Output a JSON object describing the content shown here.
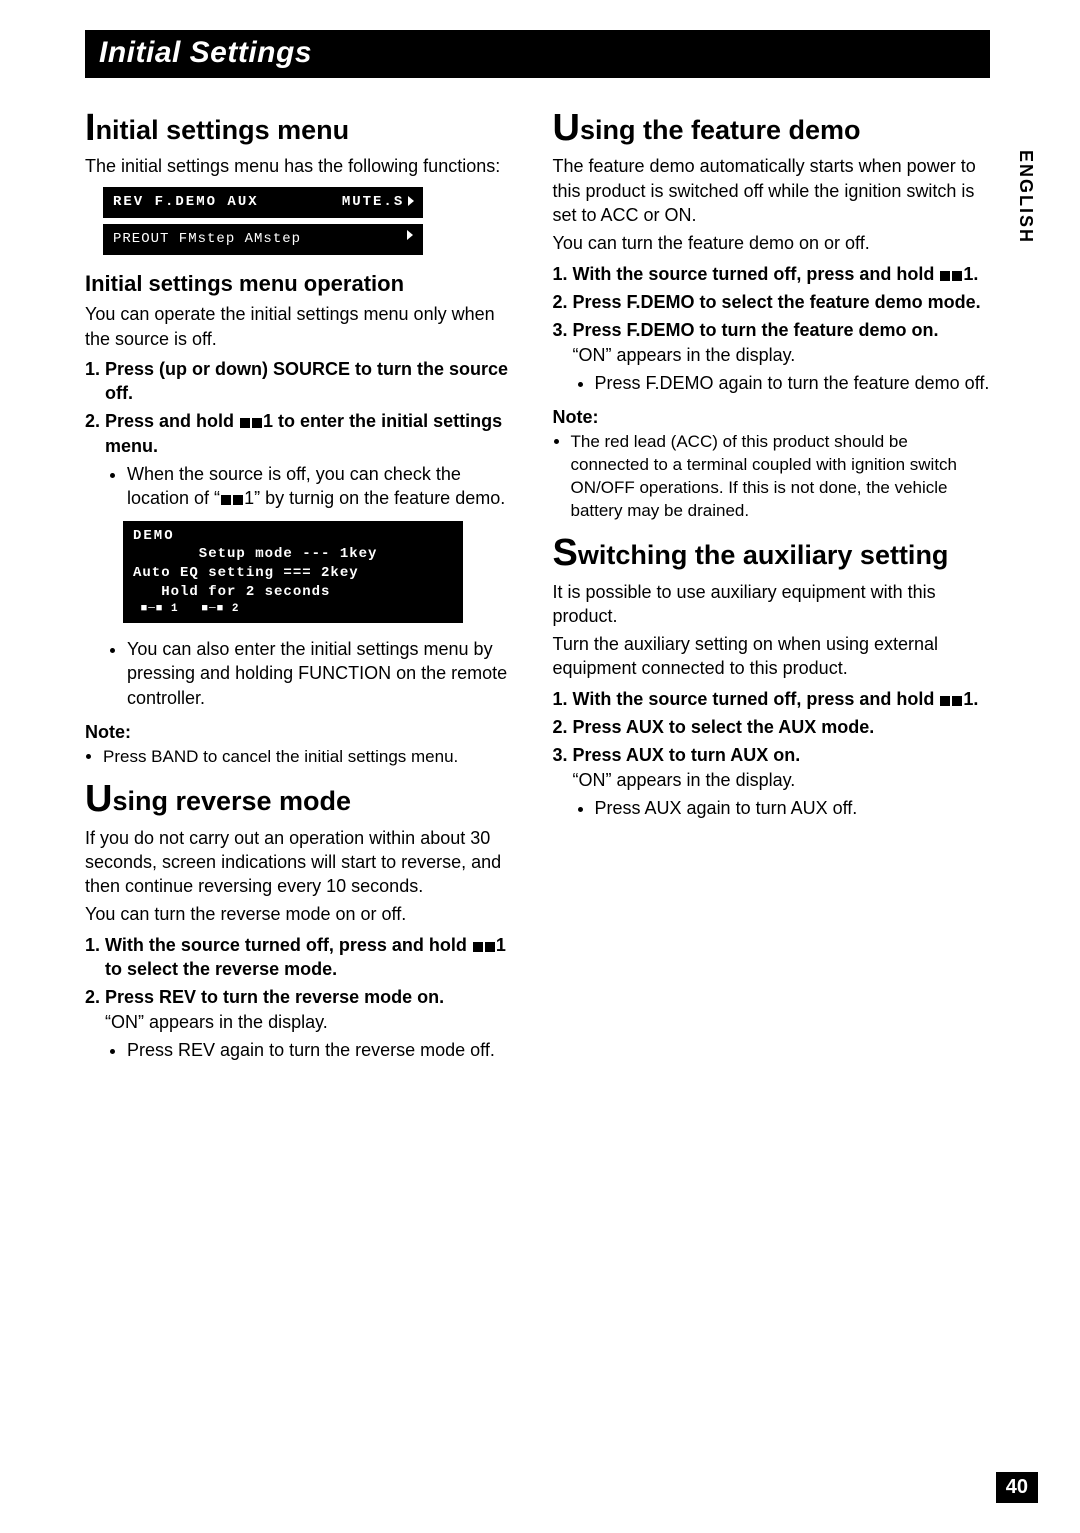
{
  "header": {
    "title": "Initial Settings"
  },
  "lang_tab": "ENGLISH",
  "page_number": "40",
  "left": {
    "h1": {
      "first": "I",
      "rest": "nitial settings menu"
    },
    "intro": "The initial settings menu has the following functions:",
    "lcd1": {
      "row1": "REV F.DEMO AUX        MUTE.S",
      "row2": "PREOUT FMstep AMstep"
    },
    "h2": "Initial settings menu operation",
    "p1": "You can operate the initial settings menu only when the source is off.",
    "step1": "Press (up or down) SOURCE to turn the source off.",
    "step2a": "Press and hold ",
    "step2b": "1 to enter the initial settings menu.",
    "sub1a": "When the source is off, you can check the location of “",
    "sub1b": "1” by turnig on the feature demo.",
    "lcd2": {
      "title": "DEMO",
      "l1": "       Setup mode --- 1key",
      "l2": "Auto EQ setting === 2key",
      "l3": "   Hold for 2 seconds",
      "l4": " ■─■ 1   ■─■ 2"
    },
    "sub2": "You can also enter the initial settings menu by pressing and holding FUNCTION on the remote controller.",
    "note_label": "Note:",
    "note_body": "Press BAND to cancel the initial settings menu.",
    "h3": {
      "first": "U",
      "rest": "sing reverse mode"
    },
    "rev_intro": "If you do not carry out an operation within about 30 seconds, screen indications will start to reverse, and then continue reversing every 10 seconds.",
    "rev_intro2": "You can turn the reverse mode on or off.",
    "rev_step1a": "With the source turned off, press and hold ",
    "rev_step1b": "1 to select the reverse mode.",
    "rev_step2": "Press REV to turn the reverse mode on.",
    "rev_on": "“ON” appears in the display.",
    "rev_sub": "Press REV again to turn the reverse mode off."
  },
  "right": {
    "h1": {
      "first": "U",
      "rest": "sing the feature demo"
    },
    "intro1": "The feature demo automatically starts when power to this product is switched off while the ignition switch is set to ACC or ON.",
    "intro2": "You can turn the feature demo on or off.",
    "step1a": "With the source turned off, press and hold ",
    "step1b": "1.",
    "step2": "Press F.DEMO to select the feature demo mode.",
    "step3": "Press F.DEMO to turn the feature demo on.",
    "on": "“ON” appears in the display.",
    "sub": "Press F.DEMO again to turn the feature demo off.",
    "note_label": "Note:",
    "note_body": "The red lead (ACC) of this product should be connected to a terminal coupled with ignition switch ON/OFF operations. If this is not done, the vehicle battery may be drained.",
    "h2": {
      "first": "S",
      "rest": "witching the auxiliary setting"
    },
    "aux_intro1": "It is possible to use auxiliary equipment with this product.",
    "aux_intro2": "Turn the auxiliary setting on when using external equipment connected to this product.",
    "aux_step1a": "With the source turned off, press and hold ",
    "aux_step1b": "1.",
    "aux_step2": "Press AUX to select the AUX mode.",
    "aux_step3": "Press AUX to turn AUX on.",
    "aux_on": "“ON” appears in the display.",
    "aux_sub": "Press AUX again to turn AUX off."
  }
}
